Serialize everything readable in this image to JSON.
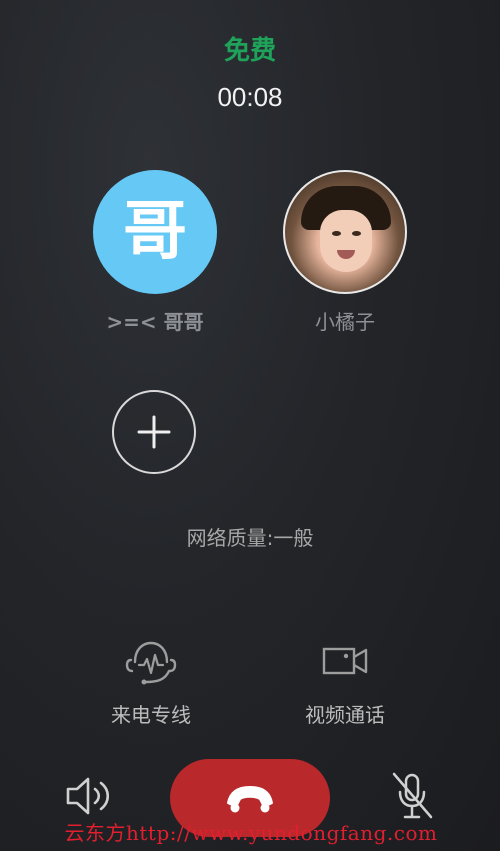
{
  "call": {
    "status": "免费",
    "timer": "00:08",
    "network_quality": "网络质量:一般"
  },
  "participants": [
    {
      "avatar_text": "哥",
      "name": ">=< 哥哥"
    },
    {
      "name": "小橘子"
    }
  ],
  "actions": {
    "hotline_label": "来电专线",
    "video_label": "视频通话"
  },
  "watermark": {
    "text": "云东方http://www.yundongfang.com"
  },
  "icons": {
    "add": "add-icon",
    "hotline": "hotline-icon",
    "video": "video-camera-icon",
    "speaker": "speaker-icon",
    "hangup": "phone-hangup-icon",
    "mute": "microphone-muted-icon"
  },
  "colors": {
    "status": "#1fa35a",
    "avatar_background": "#66c8f5",
    "hangup": "#b9282a",
    "watermark": "#e11f2f"
  }
}
